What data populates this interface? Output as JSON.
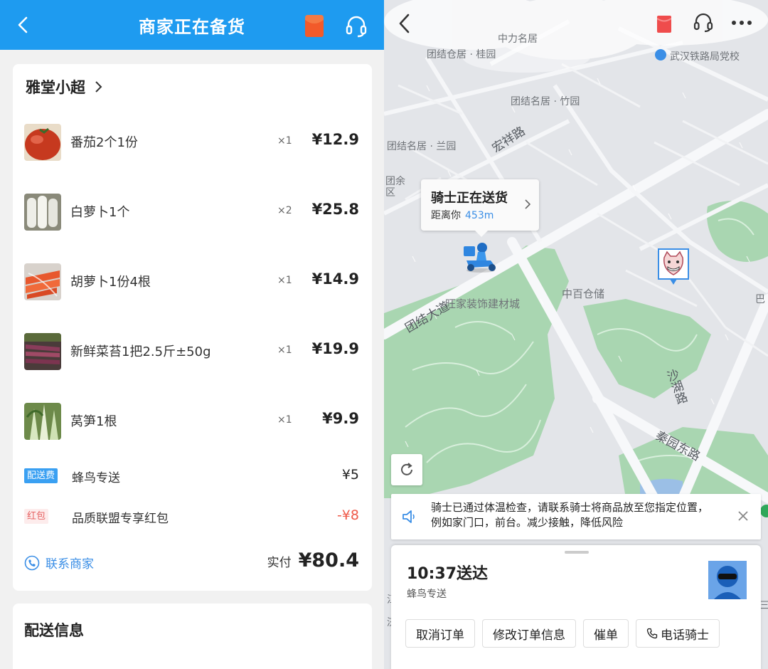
{
  "left": {
    "header": {
      "title": "商家正在备货"
    },
    "shop": {
      "name": "雅堂小超"
    },
    "items": [
      {
        "name": "番茄2个1份",
        "qty": "×1",
        "price": "¥12.9",
        "thumb": "tomato"
      },
      {
        "name": "白萝卜1个",
        "qty": "×2",
        "price": "¥25.8",
        "thumb": "radish"
      },
      {
        "name": "胡萝卜1份4根",
        "qty": "×1",
        "price": "¥14.9",
        "thumb": "carrot"
      },
      {
        "name": "新鲜菜苔1把2.5斤±50g",
        "qty": "×1",
        "price": "¥19.9",
        "thumb": "caitai"
      },
      {
        "name": "莴笋1根",
        "qty": "×1",
        "price": "¥9.9",
        "thumb": "lettuce"
      }
    ],
    "fees": [
      {
        "tag": "配送费",
        "label": "蜂鸟专送",
        "value": "¥5"
      },
      {
        "tag": "红包",
        "label": "品质联盟专享红包",
        "value": "-¥8"
      }
    ],
    "contact_label": "联系商家",
    "paid_label": "实付",
    "paid_amount": "¥80.4",
    "delivery_info_title": "配送信息"
  },
  "right": {
    "map_labels": {
      "tuanjie_lanyuan": "团结名居 · 兰园",
      "tuanjie_zhuyuan": "团结名居 · 竹园",
      "tuanjie_top": "团结仓居 · 桂园",
      "wuhan_railway": "武汉铁路局党校",
      "zhonglimingju": "中力名居",
      "wangjia": "旺家装饰建材城",
      "zhongbai": "中百仓储",
      "left_edge_1": "团余",
      "left_edge_2": "区",
      "right_edge": "巴",
      "bottom_left_1": "江",
      "bottom_left_2": "济",
      "bottom_right": "三"
    },
    "road_labels": {
      "hongxiang": "宏祥路",
      "tuanjie_dadao": "团结大道",
      "shahu": "沙湖路",
      "qinyuan_east": "秦园东路"
    },
    "rider_bubble": {
      "title": "骑士正在送货",
      "distance_prefix": "距离你",
      "distance": "453m"
    },
    "notice_text": "骑士已通过体温检查，请联系骑士将商品放至您指定位置，例如家门口，前台。减少接触，降低风险",
    "eta": {
      "time": "10:37送达",
      "service": "蜂鸟专送"
    },
    "buttons": {
      "cancel": "取消订单",
      "modify": "修改订单信息",
      "urge": "催单",
      "call": "电话骑士"
    }
  },
  "colors": {
    "header_blue": "#1e9bf0",
    "link_blue": "#3a8ee6",
    "discount_red": "#ef5a4a",
    "park_green": "#a9d6b1"
  }
}
